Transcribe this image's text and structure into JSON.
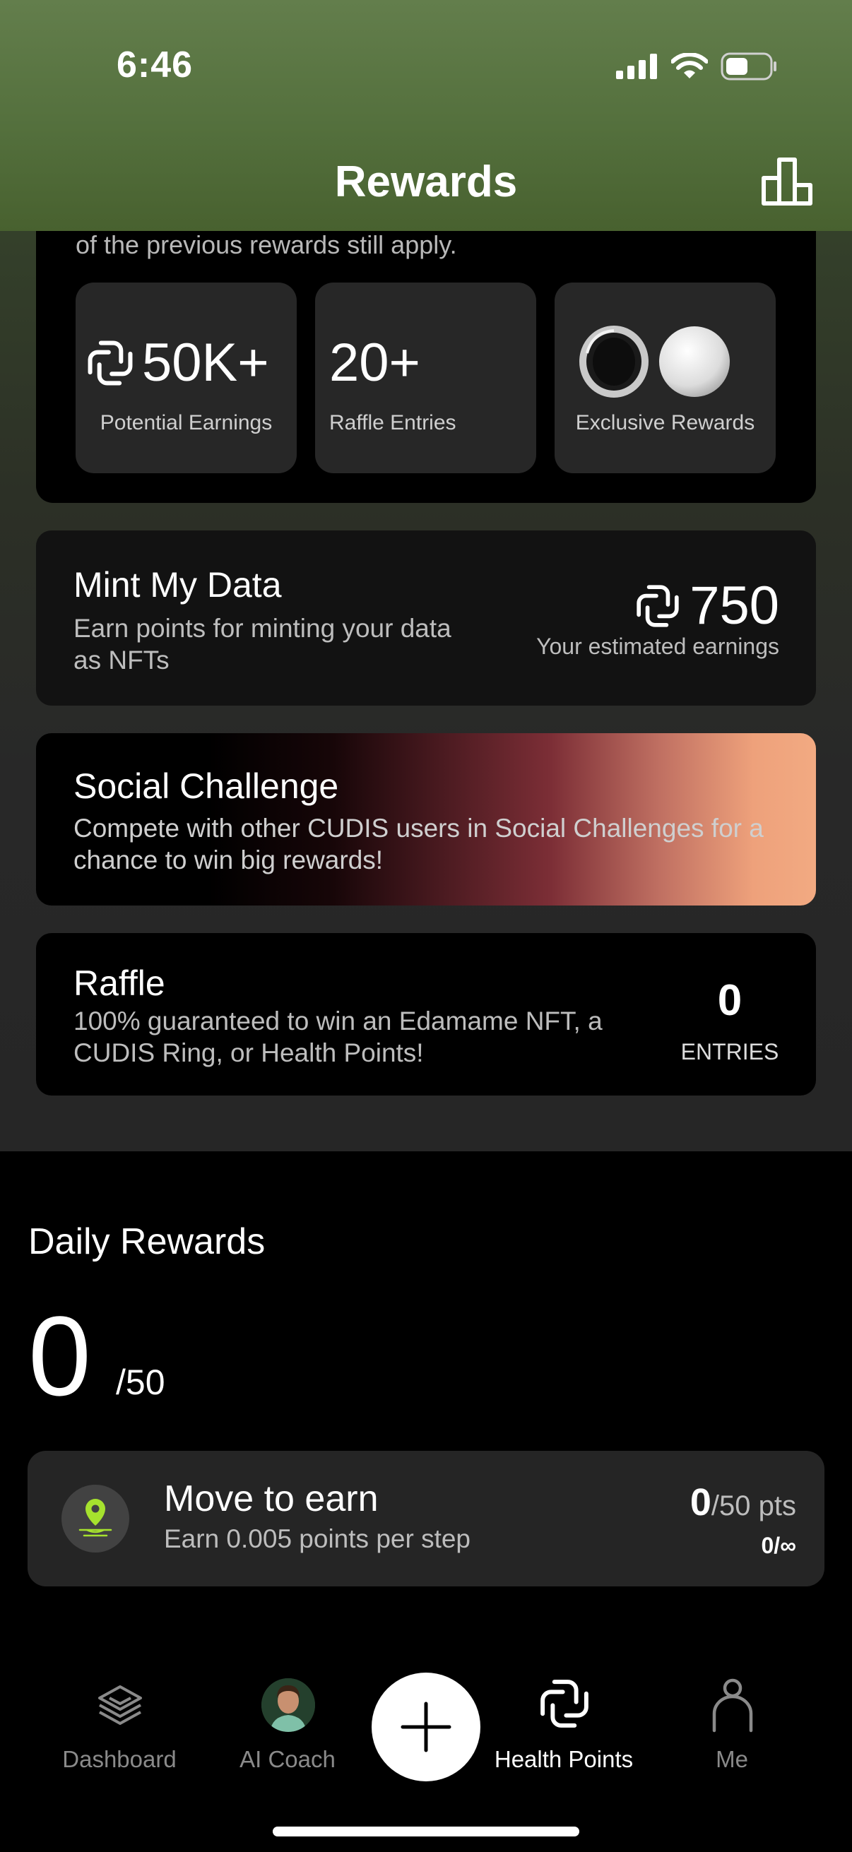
{
  "status_bar": {
    "time": "6:46"
  },
  "header": {
    "title": "Rewards"
  },
  "top_card": {
    "intro_text": "of the previous rewards still apply.",
    "stats": [
      {
        "value": "50K+",
        "label": "Potential Earnings"
      },
      {
        "value": "20+",
        "label": "Raffle Entries"
      },
      {
        "value": "",
        "label": "Exclusive Rewards"
      }
    ]
  },
  "mint": {
    "title": "Mint My Data",
    "description": "Earn points for minting your data as NFTs",
    "value": "750",
    "value_caption": "Your estimated earnings"
  },
  "social": {
    "title": "Social Challenge",
    "description": "Compete with other CUDIS users in Social Challenges for a chance to win big rewards!"
  },
  "raffle": {
    "title": "Raffle",
    "description": "100% guaranteed to win an Edamame NFT, a CUDIS Ring, or Health Points!",
    "count": "0",
    "count_label": "ENTRIES"
  },
  "daily": {
    "title": "Daily Rewards",
    "current": "0",
    "max": "/50"
  },
  "move_to_earn": {
    "title": "Move to earn",
    "description": "Earn 0.005 points per step",
    "points": "0",
    "points_suffix": "/50 pts",
    "limit": "0/∞"
  },
  "tabbar": {
    "items": [
      {
        "label": "Dashboard",
        "icon": "layers-icon"
      },
      {
        "label": "AI Coach",
        "icon": "coach-avatar"
      },
      {
        "label": "",
        "icon": "plus-icon"
      },
      {
        "label": "Health Points",
        "icon": "health-points-icon"
      },
      {
        "label": "Me",
        "icon": "person-icon"
      }
    ]
  },
  "colors": {
    "header_green": "#54703d",
    "accent_lime": "#a6e22e",
    "social_peach": "#f2aa82"
  }
}
